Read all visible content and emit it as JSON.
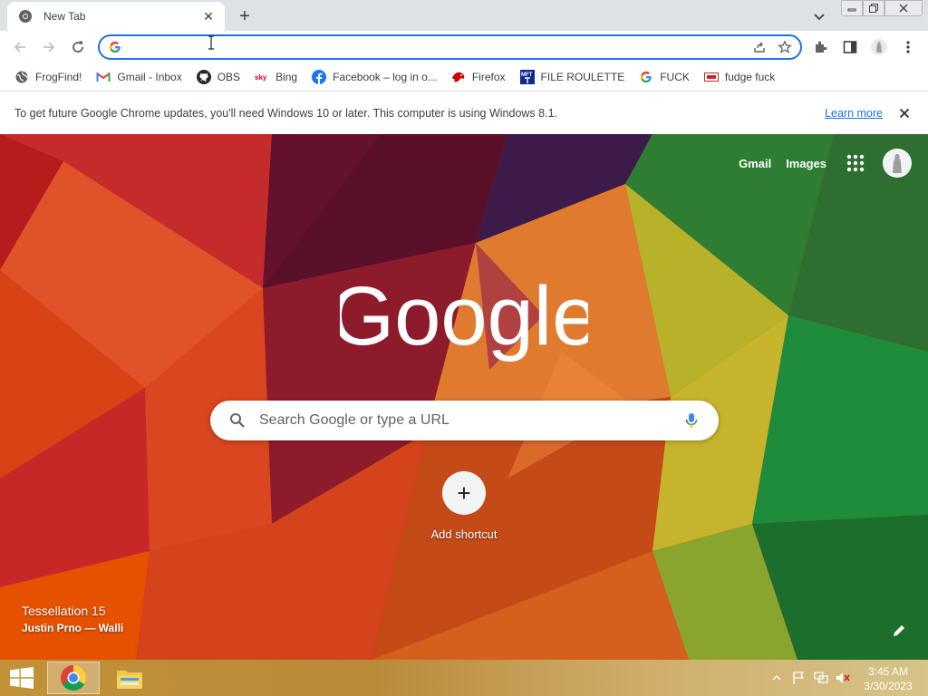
{
  "browser": {
    "tab": {
      "title": "New Tab"
    },
    "omnibox": {
      "value": "",
      "placeholder": ""
    }
  },
  "bookmarks": [
    {
      "label": "FrogFind!",
      "icon": "globe-icon"
    },
    {
      "label": "Gmail - Inbox",
      "icon": "gmail-icon"
    },
    {
      "label": "OBS",
      "icon": "github-icon"
    },
    {
      "label": "Bing",
      "icon": "sky-icon"
    },
    {
      "label": "Facebook – log in o...",
      "icon": "facebook-icon"
    },
    {
      "label": "Firefox",
      "icon": "firefox-icon"
    },
    {
      "label": "FILE ROULETTE",
      "icon": "mft-icon"
    },
    {
      "label": "FUCK",
      "icon": "google-icon"
    },
    {
      "label": "fudge fuck",
      "icon": "fudge-icon"
    }
  ],
  "infobar": {
    "message": "To get future Google Chrome updates, you'll need Windows 10 or later. This computer is using Windows 8.1.",
    "link": "Learn more"
  },
  "ntp": {
    "links": {
      "gmail": "Gmail",
      "images": "Images"
    },
    "logo_text": "Google",
    "search_placeholder": "Search Google or type a URL",
    "shortcut_label": "Add shortcut",
    "background": {
      "title": "Tessellation 15",
      "credit": "Justin Prno — Walli"
    }
  },
  "taskbar": {
    "clock": {
      "time": "3:45 AM",
      "date": "3/30/2023"
    }
  },
  "colors": {
    "accent": "#1a73e8",
    "tab_strip": "#dee1e6",
    "google_blue": "#4285f4",
    "google_red": "#ea4335",
    "google_yellow": "#fbbc05",
    "google_green": "#34a853"
  }
}
